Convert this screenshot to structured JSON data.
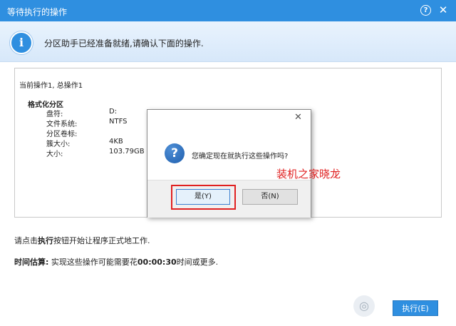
{
  "window": {
    "title": "等待执行的操作"
  },
  "banner": {
    "message": "分区助手已经准备就绪,请确认下面的操作."
  },
  "panel": {
    "current_op": "当前操作1, 总操作1",
    "section_title": "格式化分区",
    "fields": [
      {
        "label": "盘符:",
        "value": "D:"
      },
      {
        "label": "文件系统:",
        "value": "NTFS"
      },
      {
        "label": "分区卷标:",
        "value": ""
      },
      {
        "label": "簇大小:",
        "value": "4KB"
      },
      {
        "label": "大小:",
        "value": "103.79GB"
      }
    ]
  },
  "dialog": {
    "message": "您确定现在就执行这些操作吗?",
    "yes_label": "是(Y)",
    "no_label": "否(N)"
  },
  "annotation": {
    "text": "装机之家晓龙"
  },
  "footer": {
    "instruction_prefix": "请点击",
    "instruction_bold": "执行",
    "instruction_suffix": "按钮开始让程序正式地工作.",
    "estimate_label": "时间估算:",
    "estimate_prefix": " 实现这些操作可能需要花",
    "estimate_time": "00:00:30",
    "estimate_suffix": "时间或更多.",
    "execute_label": "执行(E)"
  },
  "colors": {
    "accent": "#2f8fe0",
    "highlight": "#e02020"
  },
  "icons": {
    "info": "info-icon",
    "question": "question-icon",
    "close": "close-icon",
    "help": "help-icon"
  }
}
